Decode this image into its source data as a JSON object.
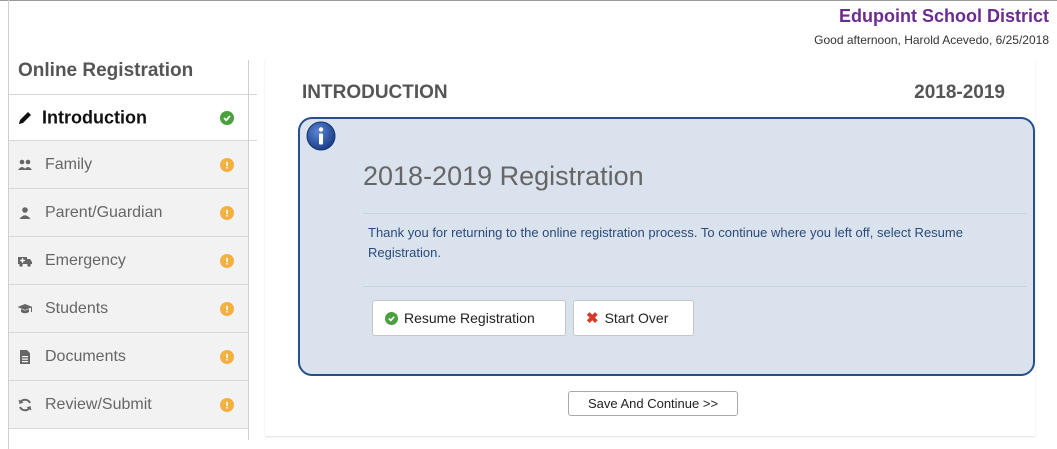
{
  "header": {
    "district_name": "Edupoint School District",
    "greeting": "Good afternoon, Harold Acevedo, 6/25/2018"
  },
  "sidebar": {
    "title": "Online Registration",
    "items": [
      {
        "label": "Introduction",
        "icon": "pencil-icon",
        "status": "complete",
        "active": true
      },
      {
        "label": "Family",
        "icon": "users-icon",
        "status": "incomplete"
      },
      {
        "label": "Parent/Guardian",
        "icon": "user-icon",
        "status": "incomplete"
      },
      {
        "label": "Emergency",
        "icon": "ambulance-icon",
        "status": "incomplete"
      },
      {
        "label": "Students",
        "icon": "graduation-cap-icon",
        "status": "incomplete"
      },
      {
        "label": "Documents",
        "icon": "document-icon",
        "status": "incomplete"
      },
      {
        "label": "Review/Submit",
        "icon": "refresh-icon",
        "status": "incomplete"
      }
    ]
  },
  "main": {
    "section_title": "INTRODUCTION",
    "school_year": "2018-2019",
    "info_box": {
      "icon": "info-icon",
      "title": "2018-2019 Registration",
      "message": "Thank you for returning to the online registration process. To continue where you left off, select Resume Registration.",
      "resume_label": "Resume Registration",
      "start_over_label": "Start Over"
    },
    "save_continue_label": "Save And Continue >>"
  },
  "colors": {
    "district": "#6a2c91",
    "box_border": "#274f8c",
    "box_background": "#dae2ee",
    "status_complete": "#4aa03f",
    "status_incomplete": "#f5b042"
  }
}
